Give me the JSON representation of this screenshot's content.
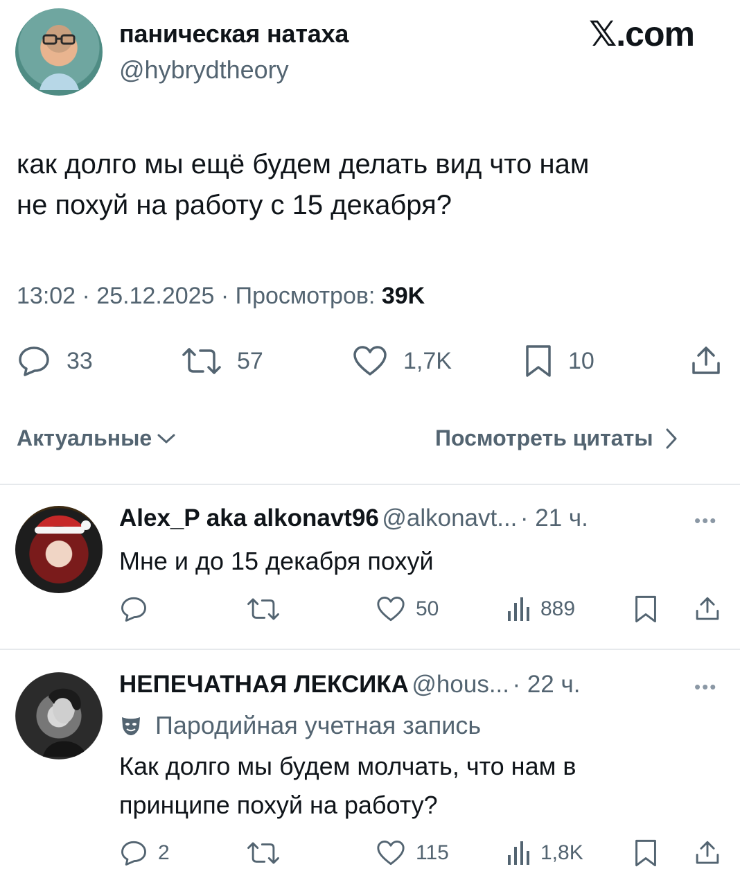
{
  "brand": "𝕏.com",
  "tweet": {
    "author_name": "паническая натаха",
    "author_handle": "@hybrydtheory",
    "text_line1": "как долго мы ещё будем делать вид что нам",
    "text_line2": "не похуй на работу с 15 декабря?",
    "time_date": "13:02 · 25.12.2025 · Просмотров: ",
    "views": "39K",
    "replies": "33",
    "retweets": "57",
    "likes": "1,7K",
    "bookmarks": "10"
  },
  "sort": {
    "relevant_label": "Актуальные",
    "quotes_label": "Посмотреть цитаты"
  },
  "replies": [
    {
      "name": "Alex_P aka alkonavt96",
      "handle": "@alkonavt...",
      "time": "· 21 ч.",
      "text_line1": "Мне и до 15 декабря похуй",
      "text_line2": "",
      "badge": "",
      "replies": "",
      "likes": "50",
      "views": "889"
    },
    {
      "name": "НЕПЕЧАТНАЯ ЛЕКСИКА",
      "handle": "@hous...",
      "time": "· 22 ч.",
      "badge": "Пародийная учетная запись",
      "text_line1": "Как долго мы будем молчать, что нам в",
      "text_line2": "принципе похуй на работу?",
      "replies": "2",
      "likes": "115",
      "views": "1,8K"
    }
  ],
  "colors": {
    "text": "#0f1419",
    "muted": "#536471",
    "divider": "#e6e9ec"
  }
}
